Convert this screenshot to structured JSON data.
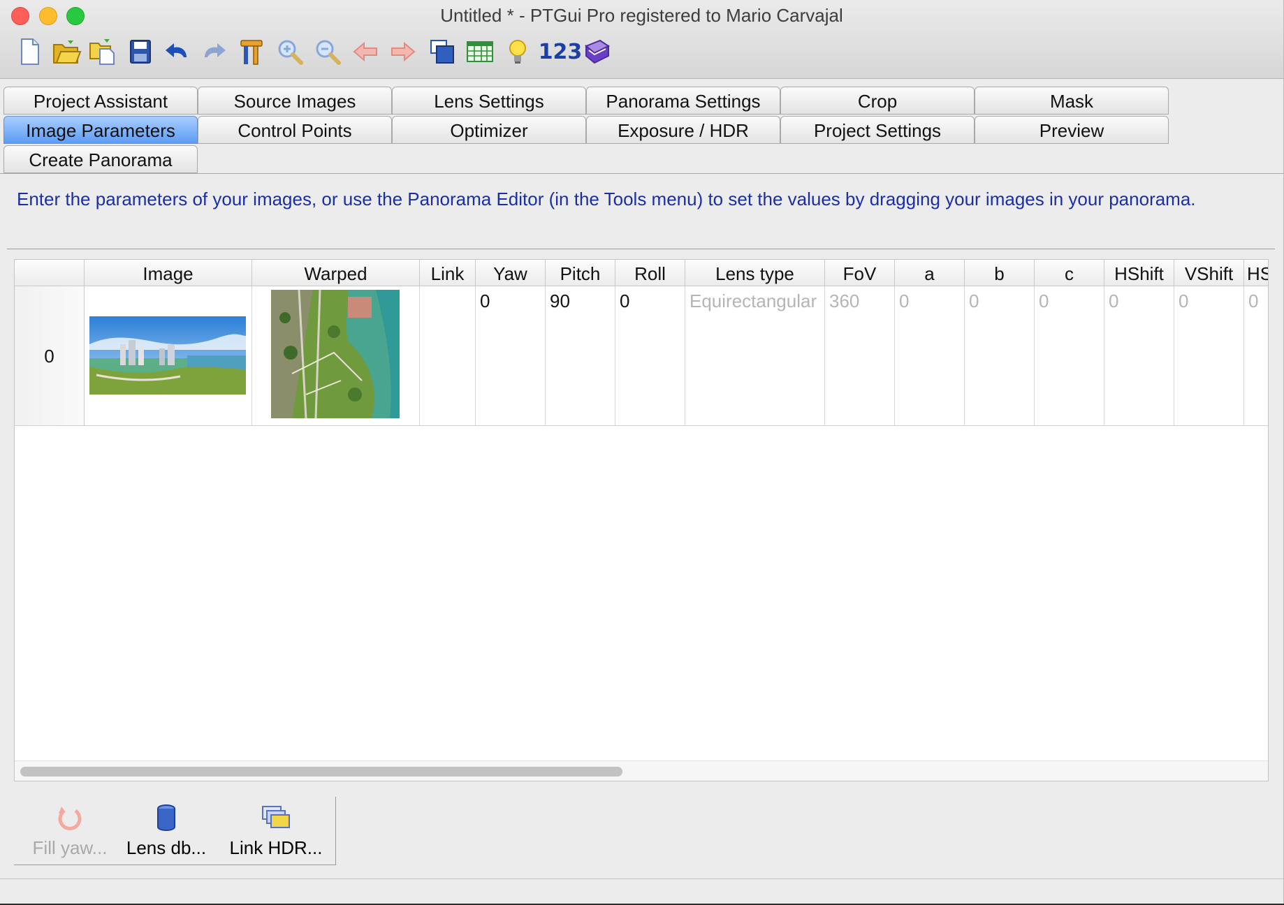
{
  "window": {
    "title": "Untitled * - PTGui Pro registered to Mario Carvajal"
  },
  "toolbar": {
    "items": [
      {
        "name": "new-document-icon"
      },
      {
        "name": "open-folder-icon"
      },
      {
        "name": "open-recent-icon"
      },
      {
        "name": "save-icon"
      },
      {
        "name": "undo-icon"
      },
      {
        "name": "redo-icon"
      },
      {
        "name": "tools-icon"
      },
      {
        "name": "zoom-in-icon"
      },
      {
        "name": "zoom-out-icon"
      },
      {
        "name": "back-arrow-icon"
      },
      {
        "name": "forward-arrow-icon"
      },
      {
        "name": "panorama-editor-icon"
      },
      {
        "name": "table-icon"
      },
      {
        "name": "lightbulb-icon"
      },
      {
        "name": "numbers-icon",
        "text": "123"
      },
      {
        "name": "help-book-icon"
      }
    ]
  },
  "tabs": {
    "row1": [
      "Project Assistant",
      "Source Images",
      "Lens Settings",
      "Panorama Settings",
      "Crop",
      "Mask"
    ],
    "row2": [
      "Image Parameters",
      "Control Points",
      "Optimizer",
      "Exposure / HDR",
      "Project Settings",
      "Preview"
    ],
    "row3": [
      "Create Panorama"
    ],
    "active": "Image Parameters"
  },
  "instructions": "Enter the parameters of your images, or use the Panorama Editor (in the Tools menu) to set the values by dragging your images in your panorama.",
  "grid": {
    "columns": [
      "Image",
      "Warped",
      "Link",
      "Yaw",
      "Pitch",
      "Roll",
      "Lens type",
      "FoV",
      "a",
      "b",
      "c",
      "HShift",
      "VShift",
      "HS"
    ],
    "rows": [
      {
        "index": "0",
        "link": "",
        "yaw": "0",
        "pitch": "90",
        "roll": "0",
        "lens_type": "Equirectangular",
        "fov": "360",
        "a": "0",
        "b": "0",
        "c": "0",
        "hshift": "0",
        "vshift": "0",
        "hs": "0"
      }
    ]
  },
  "actions": {
    "fill_yaw": "Fill yaw...",
    "lens_db": "Lens db...",
    "link_hdr": "Link HDR..."
  },
  "colors": {
    "instruction_text": "#1a2fa6",
    "active_tab": "#5d9cf5",
    "disabled_text": "#b5b5b5"
  }
}
